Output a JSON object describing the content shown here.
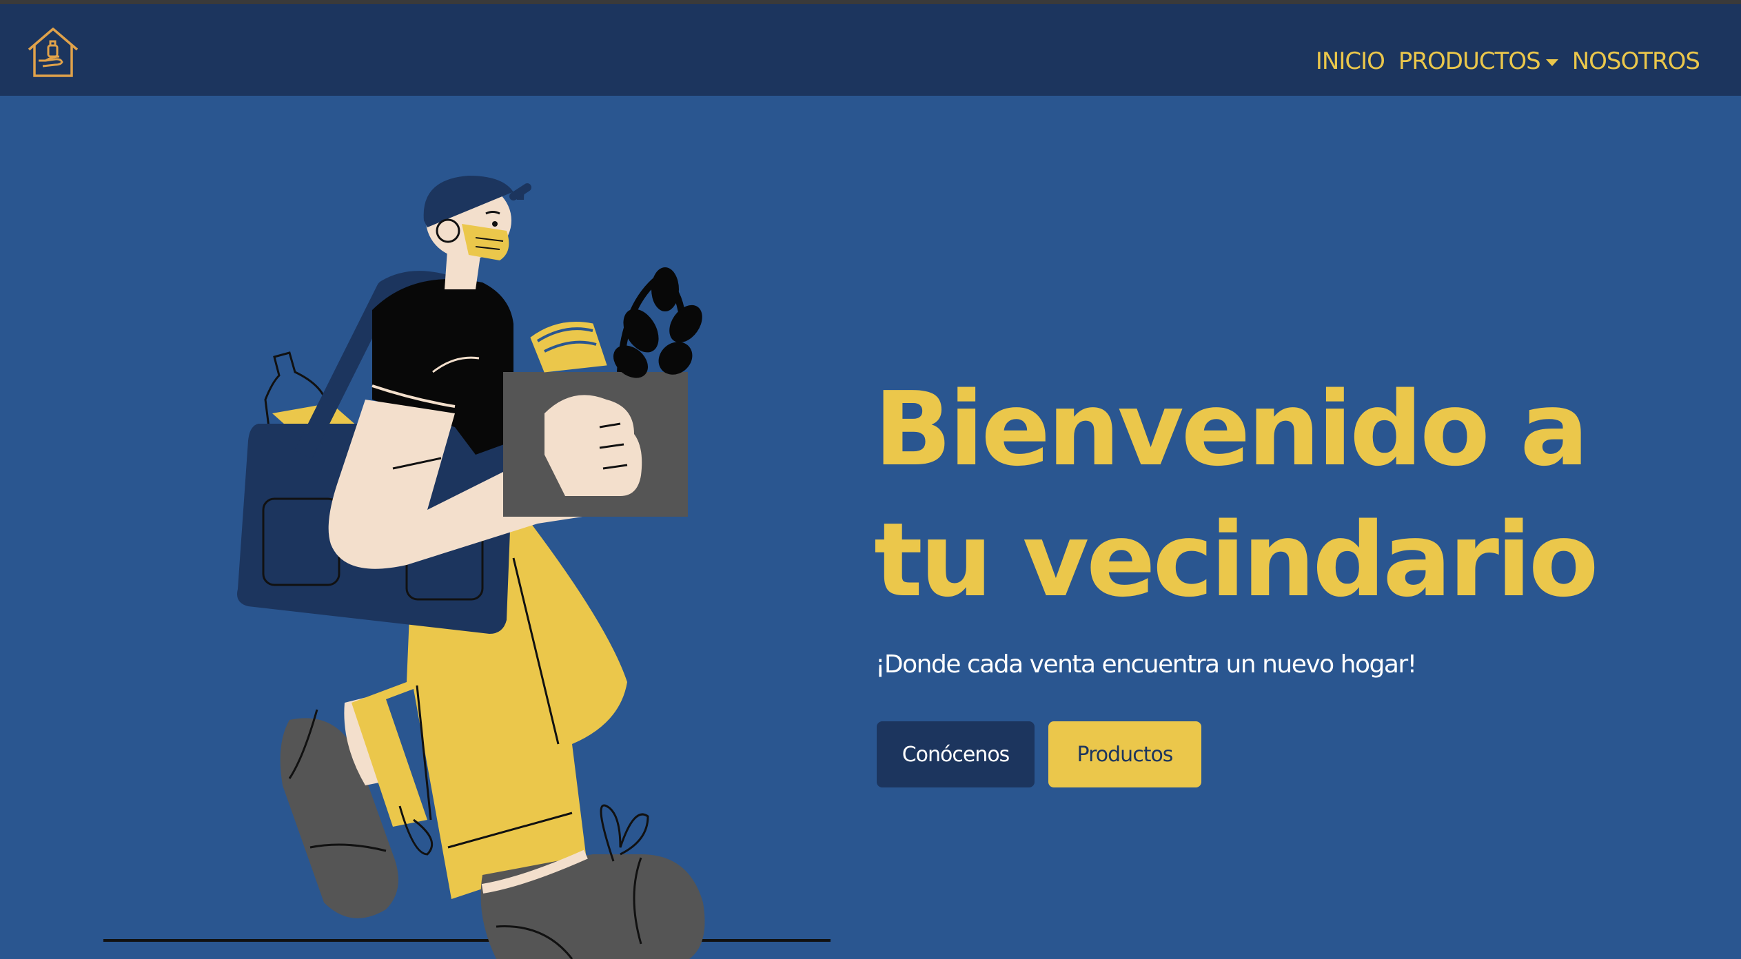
{
  "navbar": {
    "logo_icon": "house-hand-bottle-icon",
    "links": [
      {
        "label": "INICIO"
      },
      {
        "label": "PRODUCTOS",
        "dropdown": true
      },
      {
        "label": "NOSOTROS"
      }
    ]
  },
  "hero": {
    "title": "Bienvenido a tu vecindario",
    "subtitle": "¡Donde cada venta encuentra un nuevo hogar!",
    "buttons": {
      "primary": "Conócenos",
      "secondary": "Productos"
    },
    "illustration": "person-carrying-groceries-illustration"
  },
  "colors": {
    "navbar_bg": "#1c355e",
    "hero_bg": "#2a5690",
    "accent": "#ebc74b",
    "white": "#ffffff"
  }
}
